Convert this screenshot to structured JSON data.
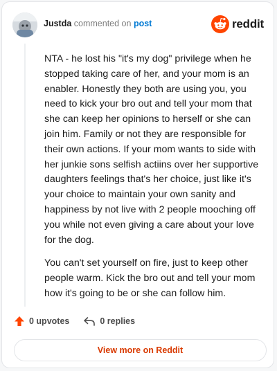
{
  "header": {
    "username": "Justda",
    "action_text": "commented on",
    "post_link": "post",
    "avatar_icon": "user-avatar",
    "brand_icon": "reddit-snoo-icon",
    "brand_word": "reddit"
  },
  "comment": {
    "paragraphs": [
      "NTA - he lost his \"it's my dog\" privilege when he stopped taking care of her, and your mom is an enabler. Honestly they both are using you, you need to kick your bro out and tell your mom that she can keep her opinions to herself or she can join him. Family or not they are responsible for their own actions. If your mom wants to side with her junkie sons selfish actiins over her supportive daughters feelings that's her choice, just like it's your choice to maintain your own sanity and happiness by not live with 2 people mooching off you while not even giving a care about your love for the dog.",
      "You can't set yourself on fire, just to keep other people warm. Kick the bro out and tell your mom how it's going to be or she can follow him."
    ]
  },
  "footer": {
    "upvotes_label": "0 upvotes",
    "replies_label": "0 replies",
    "upvote_icon": "upvote-arrow-icon",
    "reply_icon": "reply-icon"
  },
  "view_more_label": "View more on Reddit",
  "colors": {
    "accent": "#ff4500",
    "link": "#0079d3",
    "cta": "#d93a00"
  }
}
